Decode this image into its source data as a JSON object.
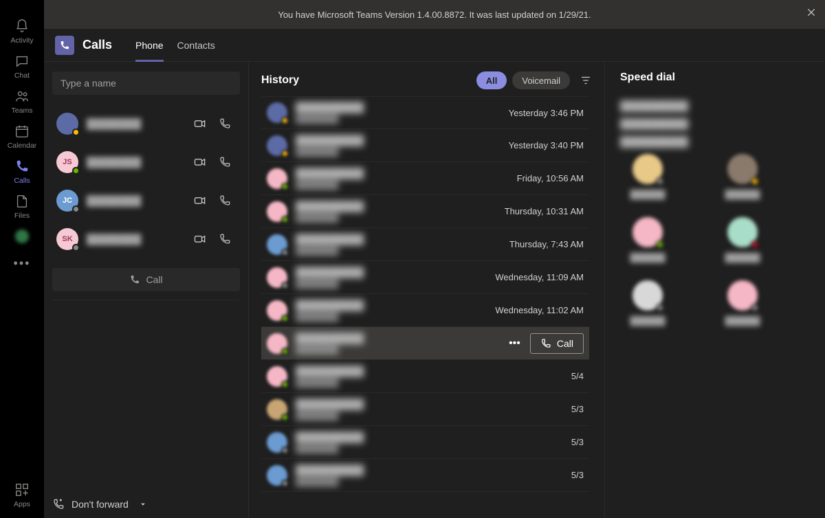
{
  "banner": {
    "text": "You have Microsoft Teams Version 1.4.00.8872. It was last updated on 1/29/21."
  },
  "rail": [
    {
      "id": "activity",
      "label": "Activity"
    },
    {
      "id": "chat",
      "label": "Chat"
    },
    {
      "id": "teams",
      "label": "Teams"
    },
    {
      "id": "calendar",
      "label": "Calendar"
    },
    {
      "id": "calls",
      "label": "Calls",
      "active": true
    },
    {
      "id": "files",
      "label": "Files"
    },
    {
      "id": "unknown",
      "label": ""
    },
    {
      "id": "more",
      "label": ""
    }
  ],
  "rail_bottom": {
    "id": "apps",
    "label": "Apps"
  },
  "header": {
    "title": "Calls",
    "tabs": [
      {
        "label": "Phone",
        "active": true
      },
      {
        "label": "Contacts",
        "active": false
      }
    ]
  },
  "leftCol": {
    "search_placeholder": "Type a name",
    "call_button_label": "Call",
    "forward_label": "Don't forward",
    "contacts": [
      {
        "initials": "",
        "bg": "#5c6aa6",
        "presence": "#ffb900",
        "name": "████████"
      },
      {
        "initials": "JS",
        "bg": "#f7c9d4",
        "text": "#9b3b5a",
        "presence": "#6bb700",
        "name": "████████"
      },
      {
        "initials": "JC",
        "bg": "#6b9bd1",
        "text": "#fff",
        "presence": "#8a8886",
        "name": "████████"
      },
      {
        "initials": "SK",
        "bg": "#f7c9d4",
        "text": "#9b3b5a",
        "presence": "#8a8886",
        "name": "████████"
      }
    ]
  },
  "history": {
    "title": "History",
    "filters": {
      "all": "All",
      "voicemail": "Voicemail"
    },
    "rows": [
      {
        "avatar_bg": "#5c6aa6",
        "presence": "#ffb900",
        "name": "██████████",
        "time": "Yesterday 3:46 PM"
      },
      {
        "avatar_bg": "#5c6aa6",
        "presence": "#ffb900",
        "name": "██████████",
        "time": "Yesterday 3:40 PM"
      },
      {
        "avatar_bg": "#f5b7c5",
        "presence": "#6bb700",
        "name": "██████████",
        "time": "Friday, 10:56 AM"
      },
      {
        "avatar_bg": "#f5b7c5",
        "presence": "#6bb700",
        "name": "██████████",
        "time": "Thursday, 10:31 AM"
      },
      {
        "avatar_bg": "#6b9bd1",
        "presence": "#8a8886",
        "name": "██████████",
        "time": "Thursday, 7:43 AM"
      },
      {
        "avatar_bg": "#f5b7c5",
        "presence": "#8a8886",
        "name": "██████████",
        "time": "Wednesday, 11:09 AM"
      },
      {
        "avatar_bg": "#f5b7c5",
        "presence": "#6bb700",
        "name": "██████████",
        "time": "Wednesday, 11:02 AM"
      },
      {
        "avatar_bg": "#f5b7c5",
        "presence": "#6bb700",
        "name": "██████████",
        "time": "",
        "hovered": true,
        "call_label": "Call"
      },
      {
        "avatar_bg": "#f5b7c5",
        "presence": "#6bb700",
        "name": "██████████",
        "time": "5/4"
      },
      {
        "avatar_bg": "#c9a574",
        "presence": "#6bb700",
        "name": "██████████",
        "time": "5/3"
      },
      {
        "avatar_bg": "#6b9bd1",
        "presence": "#8a8886",
        "name": "██████████",
        "time": "5/3"
      },
      {
        "avatar_bg": "#6b9bd1",
        "presence": "#8a8886",
        "name": "██████████",
        "time": "5/3"
      }
    ]
  },
  "speedDial": {
    "title": "Speed dial",
    "groups": [
      {
        "label": "██████████",
        "items": []
      },
      {
        "label": "██████████",
        "items": []
      },
      {
        "label": "██████████",
        "items": [
          {
            "bg": "#e8c987",
            "presence": "#8a8886",
            "name": "██████"
          },
          {
            "bg": "#8a7a6b",
            "presence": "#ffb900",
            "name": "██████"
          }
        ]
      },
      {
        "label": "",
        "items": [
          {
            "bg": "#f5b7c5",
            "presence": "#6bb700",
            "name": "██████"
          },
          {
            "bg": "#a8ddc9",
            "presence": "#c50f1f",
            "name": "██████"
          }
        ]
      },
      {
        "label": "",
        "items": [
          {
            "bg": "#d8d8d8",
            "presence": "#8a8886",
            "name": "██████"
          },
          {
            "bg": "#f5b7c5",
            "presence": "#8a8886",
            "name": "██████"
          }
        ]
      }
    ]
  }
}
